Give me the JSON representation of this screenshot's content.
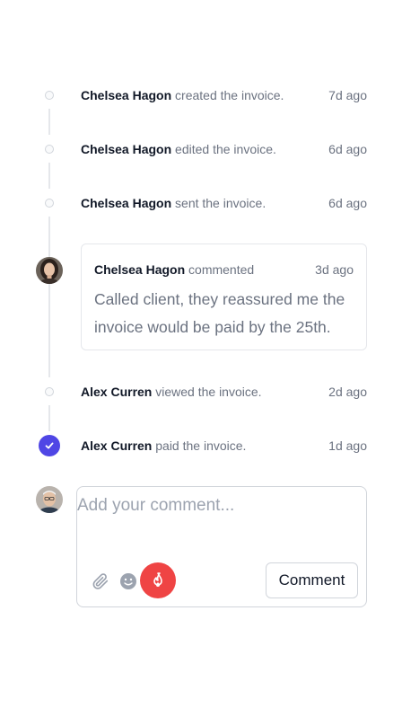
{
  "activity": [
    {
      "person": "Chelsea Hagon",
      "action": "created the invoice.",
      "date": "7d ago"
    },
    {
      "person": "Chelsea Hagon",
      "action": "edited the invoice.",
      "date": "6d ago"
    },
    {
      "person": "Chelsea Hagon",
      "action": "sent the invoice.",
      "date": "6d ago"
    },
    {
      "person": "Chelsea Hagon",
      "action": "commented",
      "date": "3d ago",
      "comment": "Called client, they reassured me the invoice would be paid by the 25th."
    },
    {
      "person": "Alex Curren",
      "action": "viewed the invoice.",
      "date": "2d ago"
    },
    {
      "person": "Alex Curren",
      "action": "paid the invoice.",
      "date": "1d ago"
    }
  ],
  "composer": {
    "placeholder": "Add your comment...",
    "submit_label": "Comment",
    "icons": [
      "paperclip-icon",
      "smiley-icon",
      "fire-icon"
    ],
    "mood_color": "#ef4444"
  },
  "colors": {
    "accent": "#4f46e5",
    "line": "#e5e7eb"
  }
}
